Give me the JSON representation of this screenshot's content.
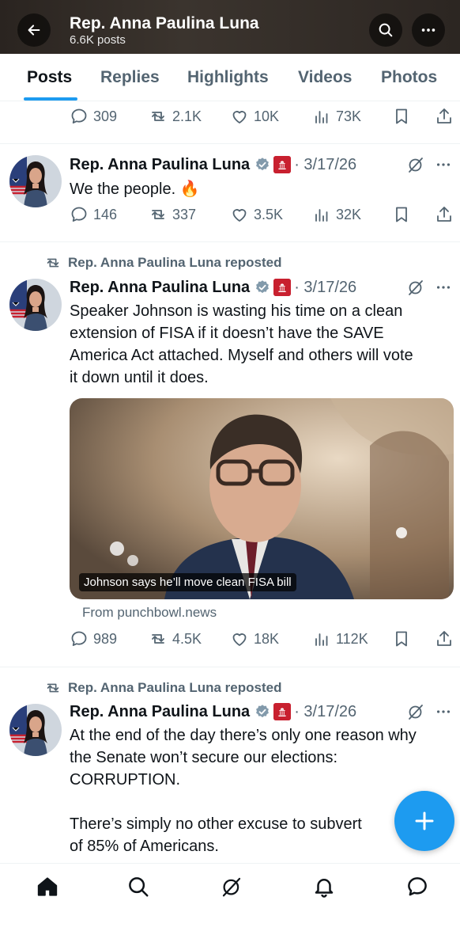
{
  "header": {
    "title": "Rep. Anna Paulina Luna",
    "subtitle": "6.6K posts"
  },
  "tabs": [
    {
      "label": "Posts",
      "active": true
    },
    {
      "label": "Replies",
      "active": false
    },
    {
      "label": "Highlights",
      "active": false
    },
    {
      "label": "Videos",
      "active": false
    },
    {
      "label": "Photos",
      "active": false
    }
  ],
  "posts": [
    {
      "metrics": {
        "replies": "309",
        "reposts": "2.1K",
        "likes": "10K",
        "views": "73K"
      }
    },
    {
      "author": "Rep. Anna Paulina Luna",
      "date": "· 3/17/26",
      "text": "We the people. 🔥",
      "metrics": {
        "replies": "146",
        "reposts": "337",
        "likes": "3.5K",
        "views": "32K"
      }
    },
    {
      "repost_label": "Rep. Anna Paulina Luna reposted",
      "author": "Rep. Anna Paulina Luna",
      "date": "· 3/17/26",
      "text_lines": [
        "Speaker Johnson is wasting his time on a clean",
        "extension of FISA if it doesn’t have the SAVE",
        "America Act attached. Myself and others will vote",
        "it down until it does."
      ],
      "card": {
        "caption": "Johnson says he’ll move clean FISA bill",
        "source": "From punchbowl.news"
      },
      "metrics": {
        "replies": "989",
        "reposts": "4.5K",
        "likes": "18K",
        "views": "112K"
      }
    },
    {
      "repost_label": "Rep. Anna Paulina Luna reposted",
      "author": "Rep. Anna Paulina Luna",
      "date": "· 3/17/26",
      "text_lines": [
        "At the end of the day there’s only one reason why",
        "the Senate won’t secure our elections:",
        "CORRUPTION.",
        "",
        "There’s simply no other excuse to subvert",
        "of 85% of Americans."
      ]
    }
  ],
  "colors": {
    "accent": "#1d9bf0",
    "text": "#0f1419",
    "muted": "#536471",
    "affiliation_badge": "#c8202f"
  },
  "icons": [
    "back-arrow-icon",
    "search-icon",
    "more-icon",
    "reply-icon",
    "repost-icon",
    "like-icon",
    "views-icon",
    "bookmark-icon",
    "share-icon",
    "verified-icon",
    "grok-icon",
    "compose-plus-icon",
    "home-icon",
    "notifications-icon",
    "messages-icon"
  ]
}
